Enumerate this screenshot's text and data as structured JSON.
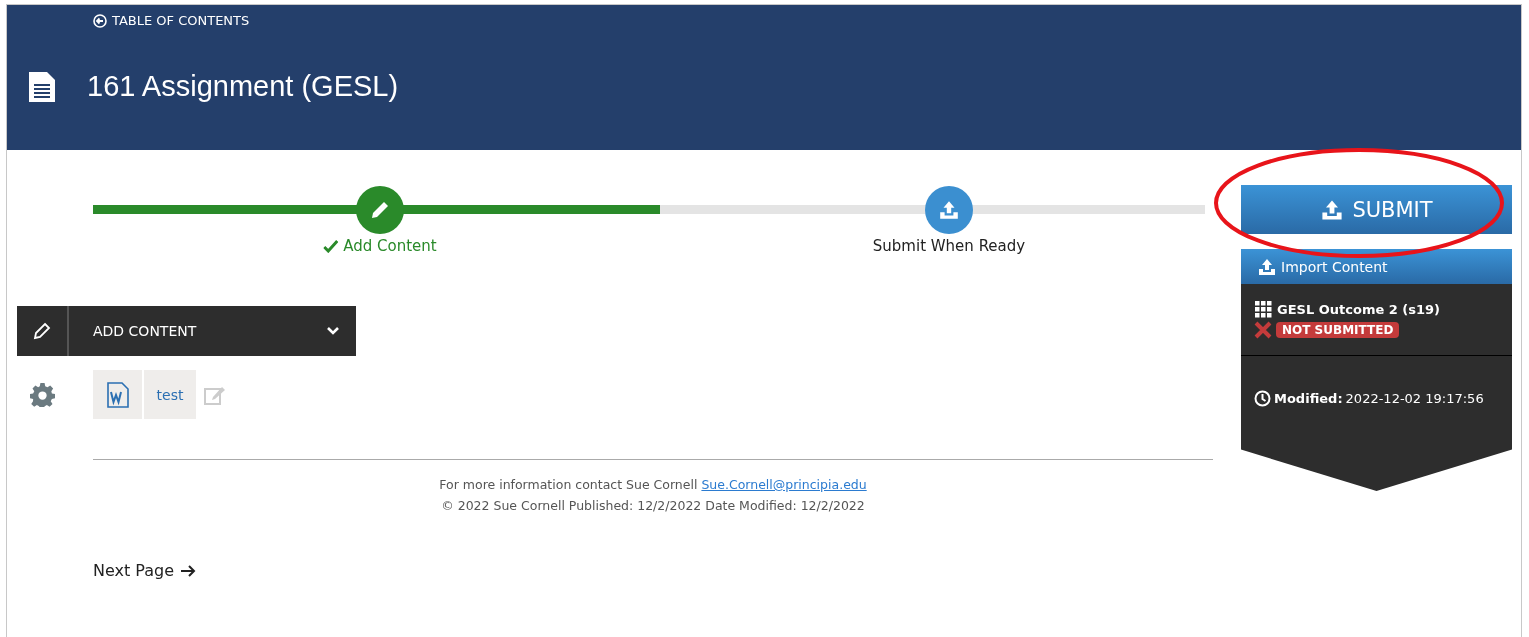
{
  "header": {
    "back_link": "TABLE OF CONTENTS",
    "title": "161 Assignment (GESL)"
  },
  "progress": {
    "level": 0.51,
    "steps": [
      {
        "label": "Add Content",
        "done": true
      },
      {
        "label": "Submit When Ready",
        "done": false
      }
    ]
  },
  "section": {
    "title": "ADD CONTENT",
    "expanded": false
  },
  "files": [
    {
      "name": "test"
    }
  ],
  "footer": {
    "contact": "For more information contact Sue Cornell",
    "email": "Sue.Cornell@principia.edu",
    "copyright": "© 2022 Sue Cornell Published: 12/2/2022 Date Modified: 12/2/2022"
  },
  "next_page": "Next Page",
  "side_panel": {
    "submit_button": "SUBMIT",
    "import_button": "Import Content",
    "outcome": "GESL Outcome 2 (s19)",
    "status": "NOT SUBMITTED",
    "modified_label": "Modified:",
    "modified_value": "2022-12-02 19:17:56"
  }
}
